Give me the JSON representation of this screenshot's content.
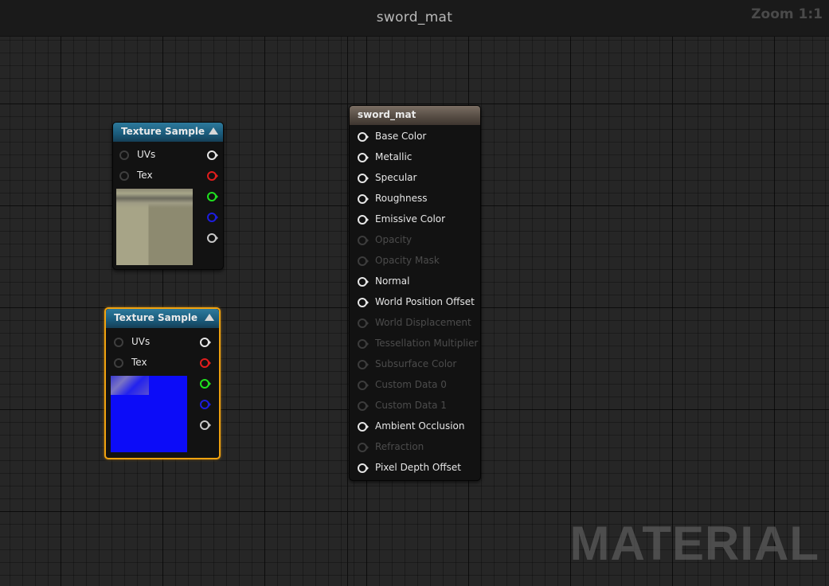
{
  "window": {
    "title": "sword_mat",
    "zoom": "Zoom 1:1",
    "watermark": "MATERIAL"
  },
  "texture_sample_1": {
    "title": "Texture Sample",
    "inputs": [
      {
        "label": "UVs"
      },
      {
        "label": "Tex"
      }
    ],
    "outputs": [
      "white",
      "red",
      "green",
      "blue",
      "gray"
    ],
    "preview_icon": "diffuse-texture-preview"
  },
  "texture_sample_2": {
    "title": "Texture Sample",
    "selected": true,
    "inputs": [
      {
        "label": "UVs"
      },
      {
        "label": "Tex"
      }
    ],
    "outputs": [
      "white",
      "red",
      "green",
      "blue",
      "gray"
    ],
    "preview_icon": "normal-map-preview"
  },
  "material_node": {
    "title": "sword_mat",
    "pins": [
      {
        "label": "Base Color",
        "enabled": true
      },
      {
        "label": "Metallic",
        "enabled": true
      },
      {
        "label": "Specular",
        "enabled": true
      },
      {
        "label": "Roughness",
        "enabled": true
      },
      {
        "label": "Emissive Color",
        "enabled": true
      },
      {
        "label": "Opacity",
        "enabled": false
      },
      {
        "label": "Opacity Mask",
        "enabled": false
      },
      {
        "label": "Normal",
        "enabled": true
      },
      {
        "label": "World Position Offset",
        "enabled": true
      },
      {
        "label": "World Displacement",
        "enabled": false
      },
      {
        "label": "Tessellation Multiplier",
        "enabled": false
      },
      {
        "label": "Subsurface Color",
        "enabled": false
      },
      {
        "label": "Custom Data 0",
        "enabled": false
      },
      {
        "label": "Custom Data 1",
        "enabled": false
      },
      {
        "label": "Ambient Occlusion",
        "enabled": true
      },
      {
        "label": "Refraction",
        "enabled": false
      },
      {
        "label": "Pixel Depth Offset",
        "enabled": true
      }
    ]
  },
  "colors": {
    "selection_outline": "#f1a20f",
    "texture_header": "#1a5a7a",
    "material_header": "#544a42",
    "pin_red": "#e01d1d",
    "pin_green": "#1fe01f",
    "pin_blue": "#1d1dde"
  }
}
